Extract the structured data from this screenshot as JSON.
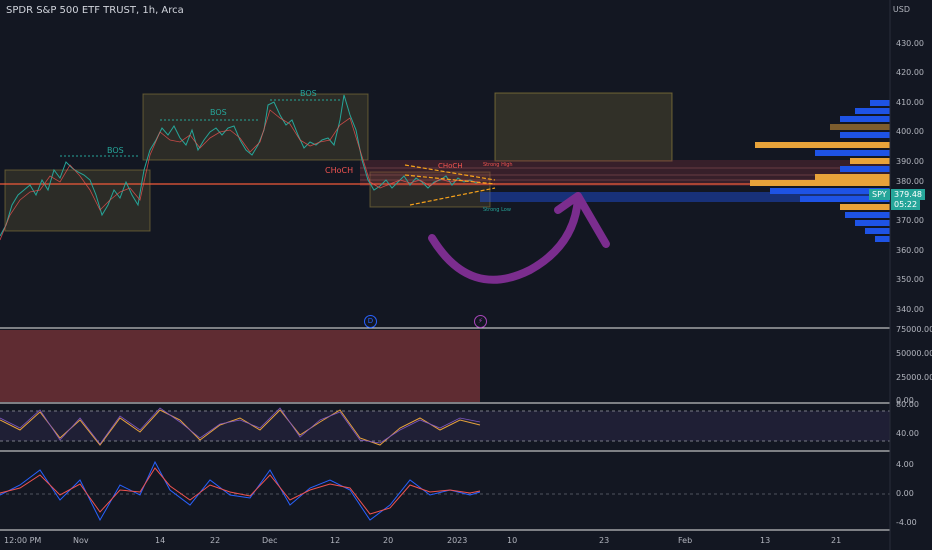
{
  "header": {
    "title": "SPDR S&P 500 ETF TRUST, 1h, Arca",
    "currency": "USD"
  },
  "price_axis": {
    "ticks": [
      "430.00",
      "420.00",
      "410.00",
      "400.00",
      "390.00",
      "380.00",
      "370.00",
      "360.00",
      "350.00",
      "340.00"
    ],
    "symbol_badge": "SPY",
    "last_price": "379.48",
    "countdown": "05:22"
  },
  "volume_axis": {
    "ticks": [
      "75000.00",
      "50000.00",
      "25000.00",
      "0.00"
    ]
  },
  "rsi_axis": {
    "ticks": [
      "80.00",
      "40.00"
    ]
  },
  "macd_axis": {
    "ticks": [
      "4.00",
      "0.00",
      "-4.00"
    ]
  },
  "time_axis": {
    "labels": [
      "12:00 PM",
      "Nov",
      "14",
      "22",
      "Dec",
      "12",
      "20",
      "2023",
      "10",
      "23",
      "Feb",
      "13",
      "21"
    ]
  },
  "annotations": {
    "bos_labels": [
      "BOS",
      "BOS",
      "BOS"
    ],
    "choch_label": "CHoCH",
    "choch_label_2": "CHoCH",
    "strong_high": "Strong High",
    "strong_low": "Strong Low"
  },
  "events": {
    "dividend_marker": "D",
    "split_marker": "⚡"
  },
  "colors": {
    "background": "#131722",
    "up": "#26a69a",
    "down": "#ef5350",
    "arrow": "#7b2d8e",
    "orange": "#f7a21b",
    "profile_blue": "#1e53e5",
    "profile_orange": "#e8a33a"
  }
}
